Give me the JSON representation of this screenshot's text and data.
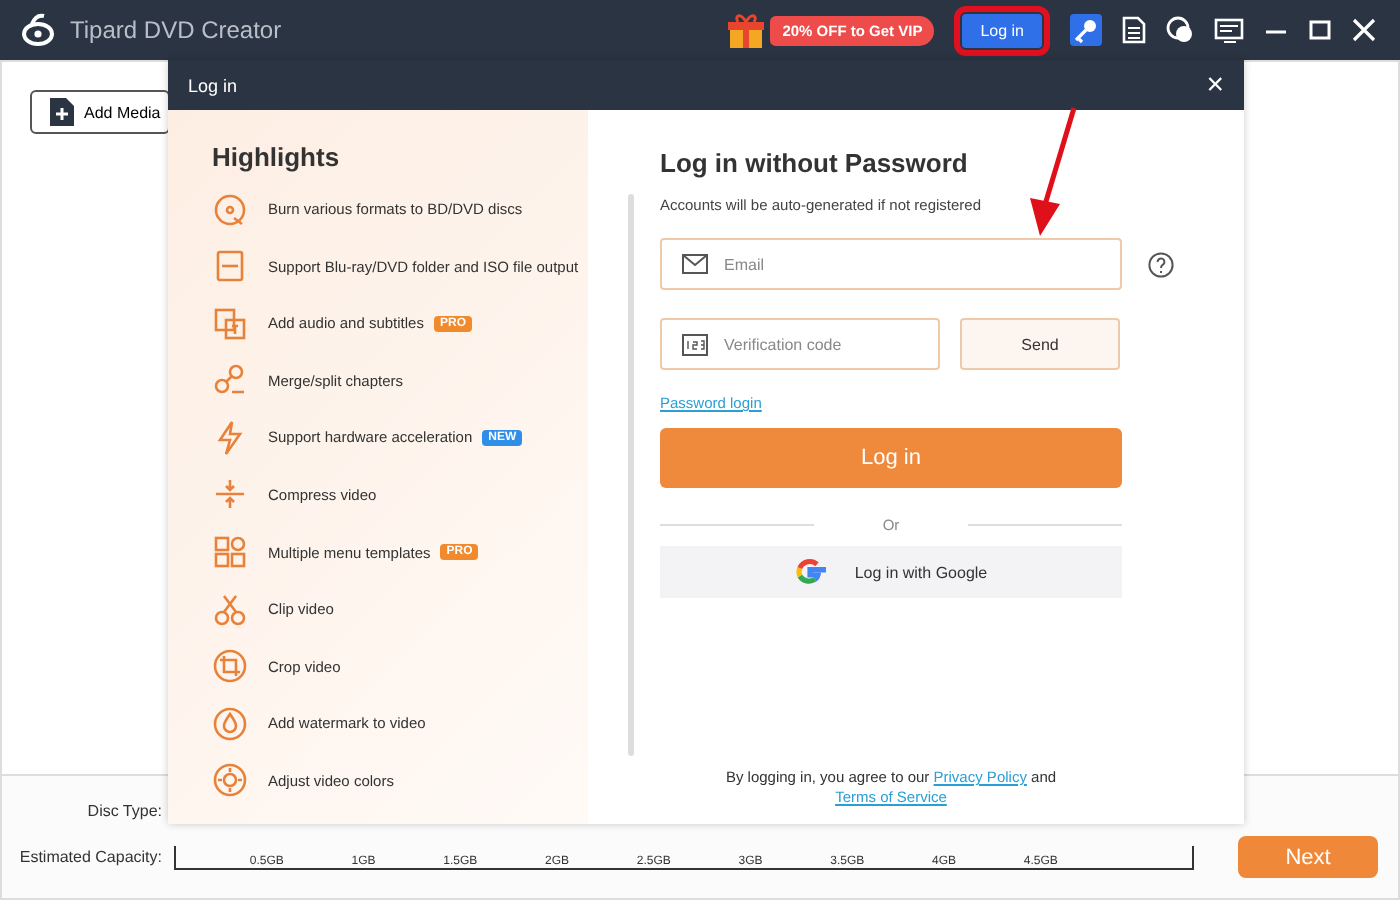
{
  "window": {
    "title": "Tipard DVD Creator"
  },
  "title_bar": {
    "promo": "20% OFF to Get VIP",
    "login_button": "Log in"
  },
  "toolbar": {
    "add_media": "Add Media"
  },
  "bottom_bar": {
    "disc_type_label": "Disc Type:",
    "capacity_label": "Estimated Capacity:",
    "capacity_ticks": [
      "0.5GB",
      "1GB",
      "1.5GB",
      "2GB",
      "2.5GB",
      "3GB",
      "3.5GB",
      "4GB",
      "4.5GB"
    ],
    "next_button": "Next"
  },
  "dialog": {
    "title": "Log in",
    "close": "×",
    "highlights": {
      "title": "Highlights",
      "items": [
        {
          "label": "Burn various formats to BD/DVD discs"
        },
        {
          "label": "Support Blu-ray/DVD folder and ISO file output"
        },
        {
          "label": "Add audio and subtitles",
          "badge": {
            "text": "PRO",
            "color": "#f08a2c"
          }
        },
        {
          "label": "Merge/split chapters"
        },
        {
          "label": "Support hardware acceleration",
          "badge": {
            "text": "NEW",
            "color": "#2f8fe8"
          }
        },
        {
          "label": "Compress video"
        },
        {
          "label": "Multiple menu templates",
          "badge": {
            "text": "PRO",
            "color": "#f08a2c"
          }
        },
        {
          "label": "Clip video"
        },
        {
          "label": "Crop video"
        },
        {
          "label": "Add watermark to video"
        },
        {
          "label": "Adjust video colors"
        }
      ]
    },
    "form": {
      "heading": "Log in without Password",
      "subtitle": "Accounts will be auto-generated if not registered",
      "email_placeholder": "Email",
      "code_placeholder": "Verification code",
      "send_button": "Send",
      "password_login_link": "Password login",
      "login_button": "Log in",
      "divider_text": "Or",
      "google_button": "Log in with Google",
      "terms_prefix": "By logging in, you agree to our",
      "privacy_link": "Privacy Policy",
      "terms_and": "and",
      "terms_link": "Terms of Service"
    }
  }
}
